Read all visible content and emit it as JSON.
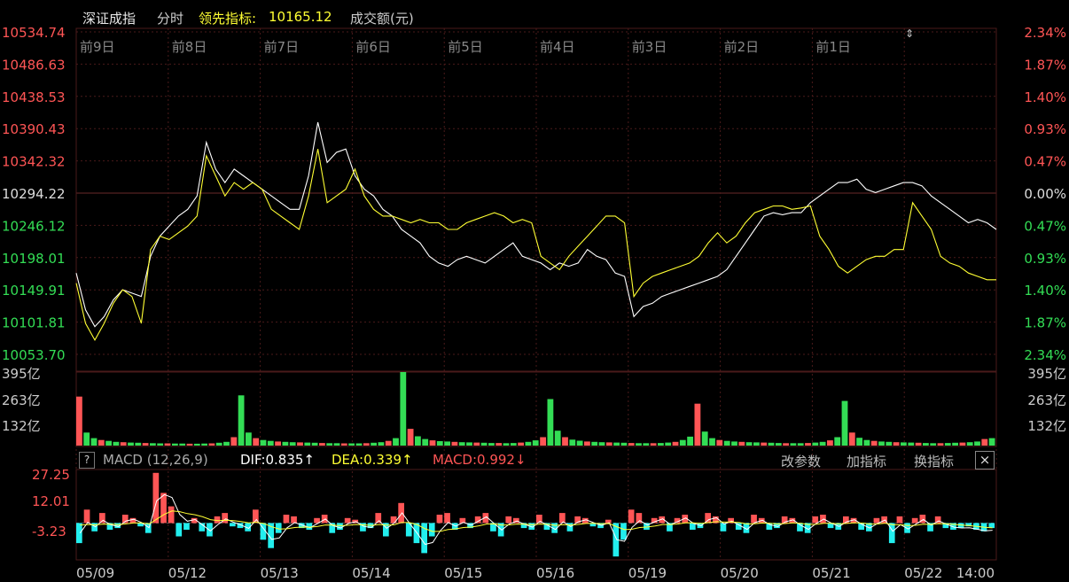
{
  "header": {
    "index_name": "深证成指",
    "mode": "分时",
    "leading_label": "领先指标:",
    "leading_value": "10165.12",
    "volume_label": "成交额(元)"
  },
  "colors": {
    "up": "#ff5555",
    "down": "#33dd55",
    "price_line": "#ffffff",
    "leading_line": "#ffff33",
    "neg_bar": "#22eeee",
    "grid": "#4a1a1a"
  },
  "chart_data": [
    {
      "type": "line",
      "name": "price",
      "y_labels_left": [
        "10534.74",
        "10486.63",
        "10438.53",
        "10390.43",
        "10342.32",
        "10294.22",
        "10246.12",
        "10198.01",
        "10149.91",
        "10101.81",
        "10053.70"
      ],
      "y_labels_right": [
        "2.34%",
        "1.87%",
        "1.40%",
        "0.93%",
        "0.47%",
        "0.00%",
        "0.47%",
        "0.93%",
        "1.40%",
        "1.87%",
        "2.34%"
      ],
      "ylim": [
        10053.7,
        10534.74
      ],
      "base": 10294.22,
      "day_labels": [
        "前9日",
        "前8日",
        "前7日",
        "前6日",
        "前5日",
        "前4日",
        "前3日",
        "前2日",
        "前1日"
      ],
      "series": [
        {
          "values": [
            10175,
            10120,
            10095,
            10110,
            10135,
            10150,
            10145,
            10140,
            10200,
            10230,
            10245,
            10260,
            10270,
            10290,
            10370,
            10330,
            10310,
            10330,
            10320,
            10310,
            10300,
            10290,
            10280,
            10270,
            10270,
            10320,
            10400,
            10340,
            10355,
            10360,
            10320,
            10300,
            10290,
            10270,
            10260,
            10240,
            10230,
            10220,
            10200,
            10190,
            10185,
            10195,
            10200,
            10195,
            10190,
            10200,
            10210,
            10220,
            10200,
            10195,
            10190,
            10180,
            10190,
            10185,
            10190,
            10210,
            10200,
            10195,
            10175,
            10170,
            10110,
            10125,
            10130,
            10140,
            10145,
            10150,
            10155,
            10160,
            10165,
            10170,
            10180,
            10200,
            10220,
            10240,
            10260,
            10265,
            10262,
            10265,
            10265,
            10280,
            10290,
            10300,
            10310,
            10310,
            10315,
            10300,
            10295,
            10300,
            10305,
            10310,
            10310,
            10305,
            10290,
            10280,
            10270,
            10260,
            10250,
            10255,
            10250,
            10240
          ]
        },
        {
          "values": [
            10160,
            10100,
            10075,
            10100,
            10130,
            10150,
            10140,
            10100,
            10210,
            10230,
            10225,
            10235,
            10245,
            10260,
            10350,
            10320,
            10290,
            10310,
            10300,
            10310,
            10300,
            10270,
            10260,
            10250,
            10240,
            10290,
            10360,
            10280,
            10290,
            10300,
            10330,
            10290,
            10270,
            10260,
            10260,
            10255,
            10250,
            10255,
            10250,
            10250,
            10240,
            10240,
            10250,
            10255,
            10260,
            10265,
            10260,
            10250,
            10255,
            10250,
            10200,
            10190,
            10180,
            10200,
            10215,
            10230,
            10245,
            10260,
            10260,
            10250,
            10140,
            10160,
            10170,
            10175,
            10180,
            10185,
            10190,
            10200,
            10220,
            10235,
            10220,
            10230,
            10250,
            10265,
            10270,
            10275,
            10275,
            10270,
            10272,
            10275,
            10230,
            10210,
            10185,
            10175,
            10185,
            10195,
            10200,
            10200,
            10210,
            10210,
            10280,
            10260,
            10240,
            10200,
            10190,
            10185,
            10175,
            10170,
            10165,
            10165
          ]
        }
      ]
    },
    {
      "type": "bar",
      "name": "turnover",
      "y_labels": [
        "395亿",
        "263亿",
        "132亿"
      ],
      "ylim": [
        0,
        395
      ],
      "values": [
        263,
        70,
        40,
        30,
        25,
        20,
        18,
        16,
        15,
        14,
        13,
        12,
        12,
        11,
        11,
        10,
        10,
        11,
        12,
        15,
        20,
        45,
        270,
        70,
        40,
        30,
        25,
        22,
        20,
        18,
        17,
        16,
        15,
        14,
        13,
        13,
        12,
        12,
        12,
        13,
        15,
        18,
        25,
        40,
        395,
        90,
        50,
        35,
        28,
        24,
        22,
        20,
        18,
        17,
        16,
        15,
        14,
        14,
        13,
        14,
        16,
        20,
        28,
        45,
        250,
        80,
        45,
        32,
        26,
        22,
        20,
        18,
        17,
        16,
        15,
        14,
        13,
        13,
        13,
        14,
        16,
        20,
        30,
        48,
        225,
        75,
        40,
        30,
        25,
        22,
        20,
        18,
        17,
        16,
        15,
        14,
        13,
        13,
        13,
        14,
        16,
        20,
        28,
        45,
        240,
        70,
        42,
        30,
        25,
        22,
        20,
        18,
        17,
        16,
        15,
        14,
        13,
        13,
        14,
        15,
        16,
        18,
        22,
        35,
        40
      ]
    },
    {
      "type": "bar",
      "name": "macd",
      "indicator": "MACD (12,26,9)",
      "dif_label": "DIF:0.835↑",
      "dea_label": "DEA:0.339↑",
      "macd_label": "MACD:0.992↓",
      "y_labels": [
        "27.25",
        "12.01",
        "-3.23"
      ],
      "ylim": [
        -22,
        32
      ],
      "values": [
        -12,
        8,
        -5,
        6,
        -4,
        -3,
        5,
        3,
        -2,
        -6,
        30,
        18,
        10,
        -8,
        -4,
        3,
        -5,
        -8,
        4,
        6,
        -2,
        -3,
        -5,
        8,
        -10,
        -15,
        -6,
        5,
        4,
        -3,
        -4,
        3,
        5,
        -6,
        -4,
        3,
        2,
        -5,
        -3,
        6,
        -8,
        4,
        12,
        -8,
        -12,
        -18,
        -8,
        5,
        6,
        -4,
        3,
        -3,
        4,
        6,
        -5,
        -8,
        4,
        3,
        -3,
        -4,
        5,
        -4,
        -6,
        6,
        -5,
        4,
        3,
        -2,
        -3,
        2,
        -20,
        -10,
        8,
        6,
        -4,
        3,
        4,
        -5,
        3,
        5,
        -4,
        -3,
        6,
        4,
        -5,
        3,
        -4,
        -6,
        5,
        3,
        -4,
        -3,
        4,
        3,
        -5,
        -6,
        4,
        5,
        -3,
        -4,
        4,
        3,
        -4,
        -5,
        3,
        4,
        -12,
        4,
        -6,
        3,
        5,
        -5,
        4,
        -3,
        -4,
        -3,
        -2,
        -4,
        -5,
        -3
      ],
      "x_labels": [
        "05/09",
        "05/12",
        "05/13",
        "05/14",
        "05/15",
        "05/16",
        "05/19",
        "05/20",
        "05/21",
        "05/22",
        "14:00"
      ],
      "buttons": [
        "改参数",
        "加指标",
        "换指标"
      ]
    }
  ]
}
